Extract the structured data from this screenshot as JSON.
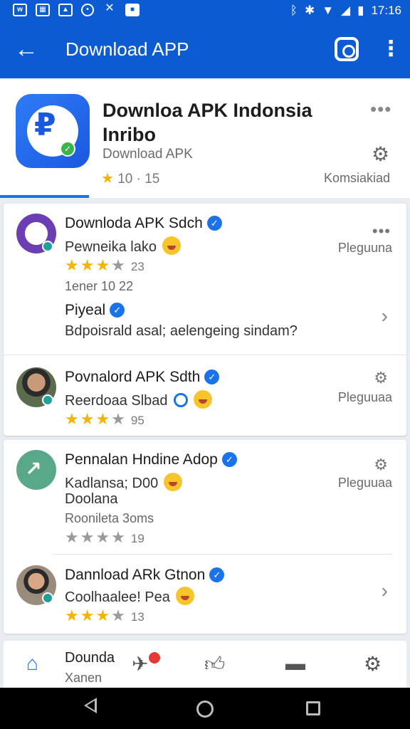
{
  "status_bar": {
    "time": "17:16",
    "left_icons": [
      "messages-icon",
      "gallery-icon",
      "photo-icon",
      "clock-icon",
      "tools-icon",
      "bag-icon"
    ],
    "right_icons": [
      "bluetooth-icon",
      "bluetooth-icon",
      "wifi-icon",
      "signal-icon",
      "battery-icon"
    ]
  },
  "app_bar": {
    "title": "Download APP",
    "back_icon": "←",
    "more_icon": "⋮"
  },
  "app_header": {
    "name": "Downloa APK Indonsia Inribo",
    "subtitle": "Download APK",
    "rating": "10 · 15",
    "action": "Komsiakiad",
    "more": "•••",
    "gear": "⚙"
  },
  "feed": {
    "card1": [
      {
        "title": "Downloda APK Sdch",
        "line": "Pewneika lako",
        "stars_on": "★★★",
        "stars_half": "★",
        "stars_off": "",
        "rating_num": "23",
        "meta": "1ener 10 22",
        "side": "Pleguuna",
        "sub_title": "Piyeal",
        "sub_line": "Bdpoisrald asal; aelengeing sindam?"
      },
      {
        "title": "Povnalord APK Sdth",
        "line": "Reerdoaa Slbad",
        "stars_on": "★★★",
        "stars_half": "★",
        "stars_off": "",
        "rating_num": "95",
        "side": "Pleguuaa"
      }
    ],
    "card2": [
      {
        "title": "Pennalan Hndine Adop",
        "line": "Kadlansa; D00",
        "line2": "Doolana",
        "meta": "Roonileta 3oms",
        "stars_on": "",
        "stars_half": "",
        "stars_off": "★★★★",
        "rating_num": "19",
        "side": "Pleguuaa"
      },
      {
        "title": "Dannload ARk Gtnon",
        "line": "Coolhaalee! Pea",
        "stars_on": "★★★",
        "stars_half": "★",
        "stars_off": "",
        "rating_num": "13"
      }
    ]
  },
  "bottom_nav": {
    "label_1": "Dounda",
    "label_2": "Xanen",
    "icons": [
      "home-icon",
      "megaphone-icon",
      "thumbs-up-icon",
      "chat-icon",
      "settings-icon"
    ]
  },
  "colors": {
    "primary": "#0d5bd3",
    "accent": "#1a73e8",
    "star": "#f4b400",
    "badge": "#e53935",
    "verified": "#1a73e8"
  }
}
